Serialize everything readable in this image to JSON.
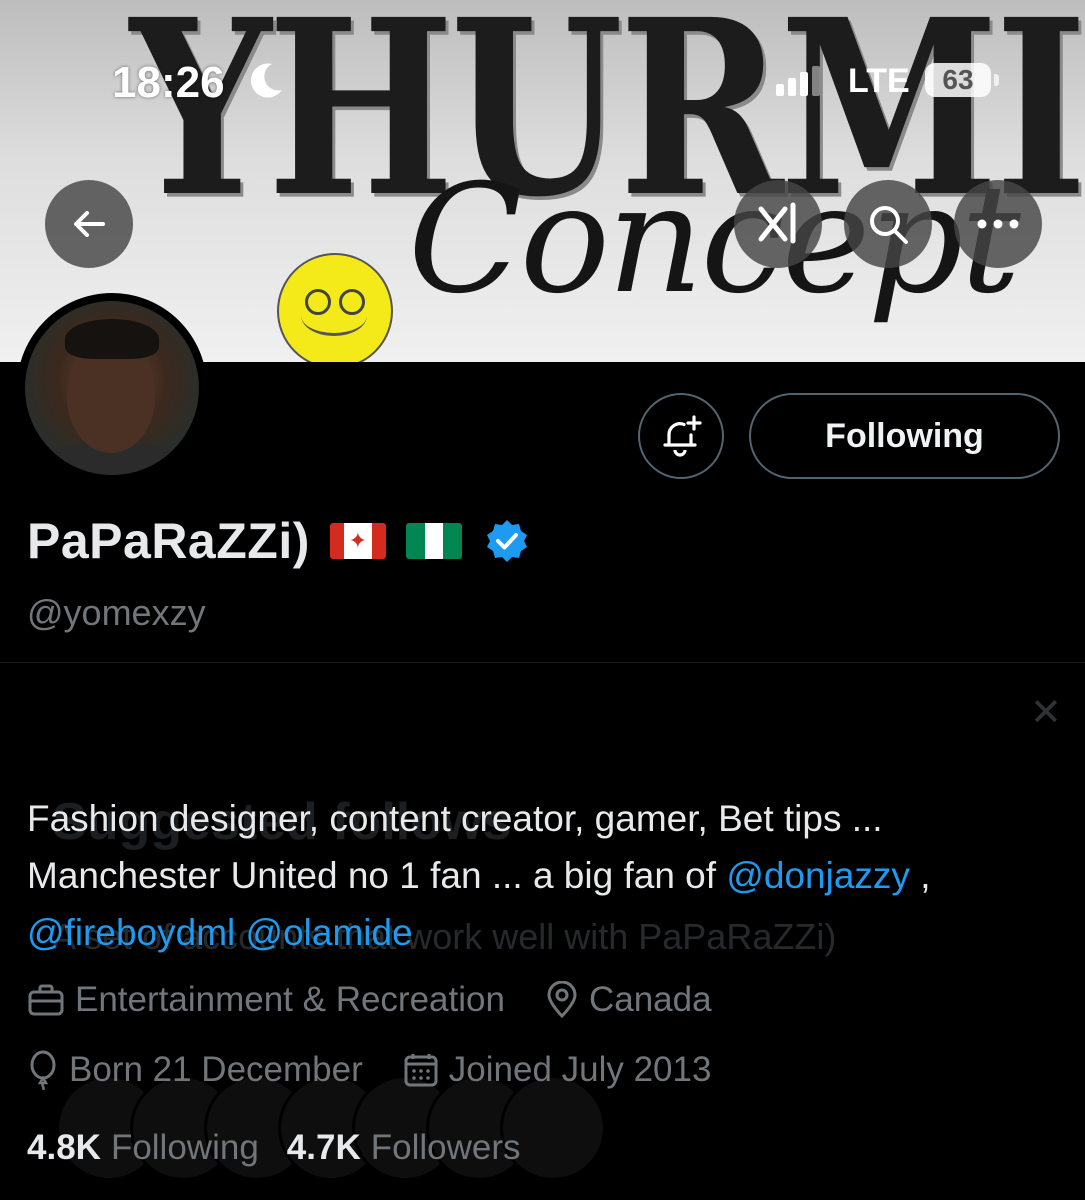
{
  "status_bar": {
    "time": "18:26",
    "network": "LTE",
    "battery": "63"
  },
  "banner": {
    "title": "YHURMIE",
    "subtitle": "Concept"
  },
  "header_buttons": {
    "grok_label": "x̸"
  },
  "actions": {
    "following_label": "Following"
  },
  "profile": {
    "display_name": "PaPaRaZZi)",
    "handle": "@yomexzy",
    "bio_line1": "Fashion designer, content creator, gamer, Bet tips ...",
    "bio_line2_prefix": "Manchester United no 1 fan ... a big fan of ",
    "bio_mention1": "@donjazzy",
    "bio_line2_suffix": " ,",
    "bio_mention2": "@fireboydml",
    "bio_mention3": "@olamide",
    "category": "Entertainment & Recreation",
    "location": "Canada",
    "birthday": "Born 21 December",
    "joined": "Joined July 2013",
    "following_count": "4.8K",
    "following_label": "Following",
    "followers_count": "4.7K",
    "followers_label": "Followers"
  },
  "ghost_overlay": {
    "title": "Suggested follows",
    "subtitle": "A set of accounts that work well with PaPaRaZZi)"
  },
  "colors": {
    "accent": "#1d9bf0",
    "background": "#000000",
    "muted": "#71767b"
  },
  "icons": [
    "back-arrow-icon",
    "grok-icon",
    "search-icon",
    "more-icon",
    "bell-plus-icon",
    "verified-badge-icon",
    "briefcase-icon",
    "location-pin-icon",
    "balloon-icon",
    "calendar-icon",
    "moon-icon",
    "signal-icon",
    "battery-icon"
  ]
}
